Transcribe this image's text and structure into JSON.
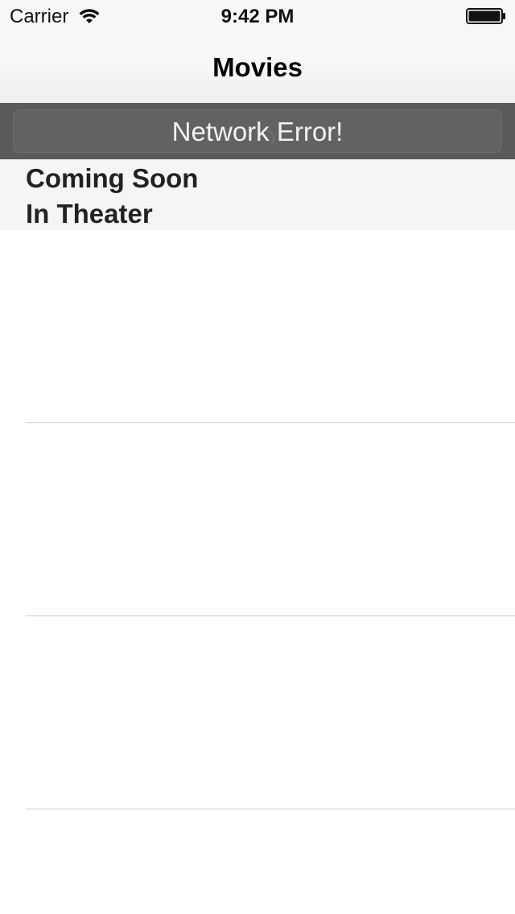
{
  "status_bar": {
    "carrier": "Carrier",
    "time": "9:42 PM",
    "wifi_icon": "wifi-icon",
    "battery_icon": "battery-full-icon"
  },
  "nav_bar": {
    "title": "Movies"
  },
  "error_banner": {
    "message": "Network Error!",
    "background_color": "#5a5a5a"
  },
  "segments": {
    "items": [
      {
        "label": "Coming Soon"
      },
      {
        "label": "In Theater"
      }
    ]
  },
  "table": {
    "row_count": 4
  }
}
